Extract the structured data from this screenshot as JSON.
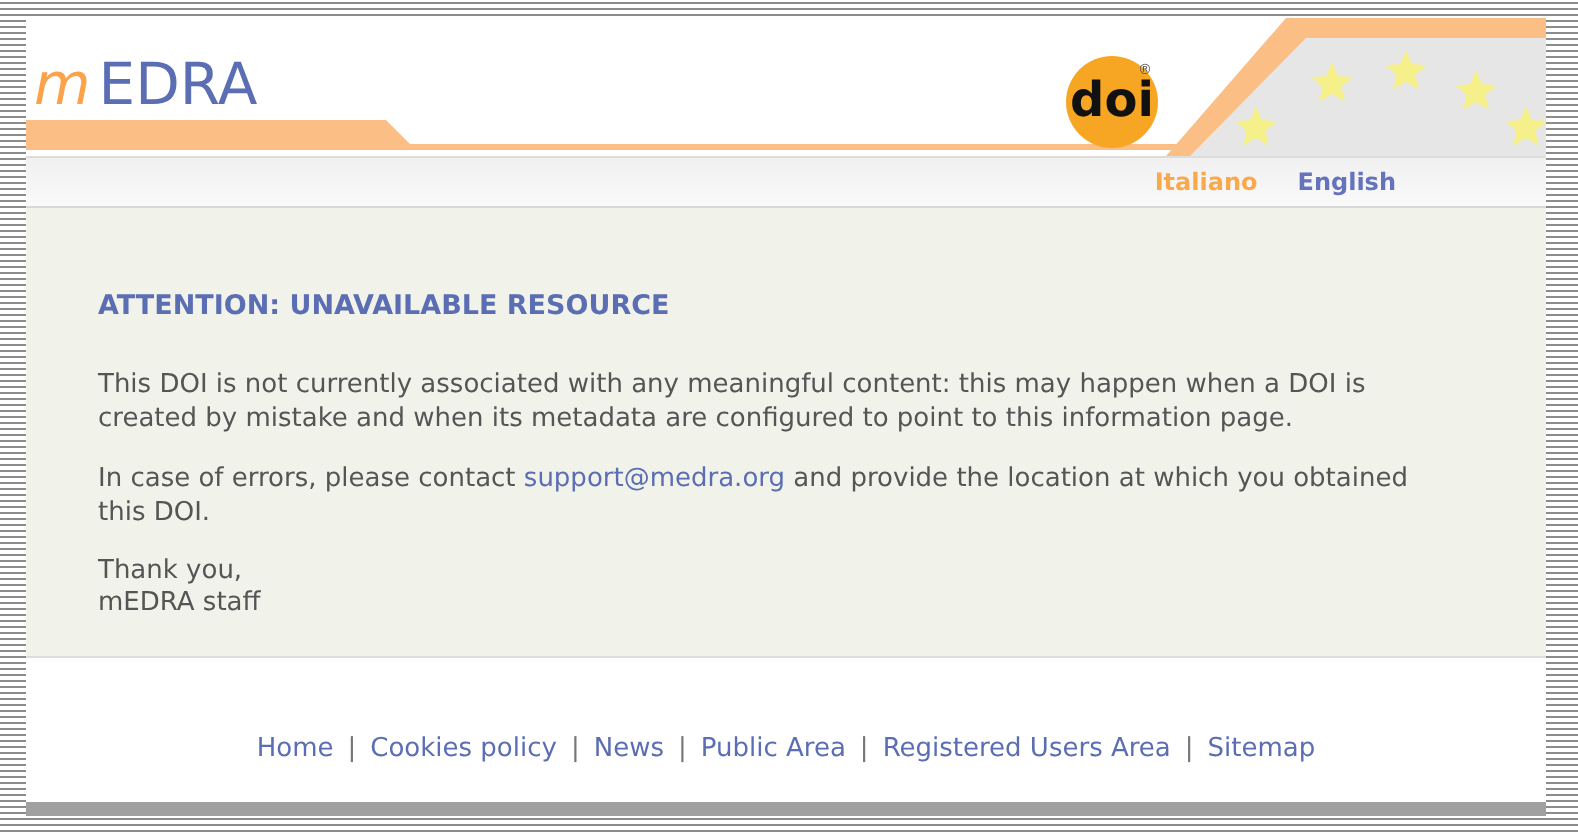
{
  "header": {
    "logo": {
      "prefix": "m",
      "name": "EDRA"
    },
    "doi_logo": {
      "text": "doi",
      "mark": "®"
    }
  },
  "languages": [
    {
      "label": "Italiano",
      "selected": true
    },
    {
      "label": "English",
      "selected": false
    }
  ],
  "content": {
    "title": "ATTENTION: UNAVAILABLE RESOURCE",
    "paragraph_1": "This DOI is not currently associated with any meaningful content: this may happen when a DOI is created by mistake and when its metadata are configured to point to this information page.",
    "paragraph_2": {
      "before": "In case of errors, please contact ",
      "link": "support@medra.org",
      "after": " and provide the location at which you obtained this DOI."
    },
    "signature": [
      "Thank you,",
      "mEDRA staff"
    ]
  },
  "footer": [
    {
      "kind": "link",
      "text": "Home"
    },
    {
      "kind": "separator",
      "text": "|"
    },
    {
      "kind": "link",
      "text": "Cookies policy"
    },
    {
      "kind": "separator",
      "text": "|"
    },
    {
      "kind": "link",
      "text": "News"
    },
    {
      "kind": "separator",
      "text": "|"
    },
    {
      "kind": "link",
      "text": "Public Area"
    },
    {
      "kind": "separator",
      "text": "|"
    },
    {
      "kind": "link",
      "text": "Registered Users Area"
    },
    {
      "kind": "separator",
      "text": "|"
    },
    {
      "kind": "link",
      "text": "Sitemap"
    }
  ]
}
